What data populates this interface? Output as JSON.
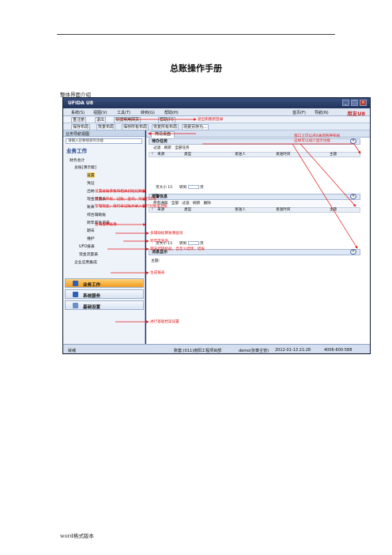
{
  "doc": {
    "title": "总账操作手册",
    "section": "整体界面介绍",
    "footer": "word格式版本"
  },
  "app": {
    "window_title": "UFIDA U8",
    "brand": "用友U8",
    "menus": [
      "系统(S)",
      "视图(V)",
      "工具(T)",
      "转到(G)",
      "帮助(H)"
    ],
    "home_links": [
      "首页(F)",
      "导航(N)"
    ],
    "toolbar1": [
      "重注册",
      "退出",
      "快捷常用网页",
      "帮助(H)"
    ],
    "toolbar2": [
      "保存布局",
      "恢复布局",
      "保存所有布局",
      "恢复所有布局",
      "场景另存为..."
    ],
    "nav": {
      "header": "业务导航视图",
      "search_placeholder": "请输入您要搜索的功能",
      "section": "业务工作",
      "tree": [
        "财务会计",
        "总账[演示版]",
        "设置",
        "凭证",
        "出纳",
        "现金流量表",
        "账表",
        "综合辅助账",
        "跨年度查询表",
        "期末",
        "维护",
        "UFO报表",
        "现金流量表",
        "企业应用集成"
      ],
      "buttons": [
        "业务工作",
        "系统服务",
        "基础设置"
      ]
    },
    "main": {
      "tab": "简易桌面",
      "panels": [
        {
          "title": "待办任务",
          "tools": [
            "过滤",
            "刷新",
            "全部任务"
          ],
          "columns": [
            "!",
            "来源",
            "类型",
            "发送人",
            "发送时间",
            "主题"
          ],
          "page_size_label": "页大小",
          "page_size": "15",
          "goto_label": "转到",
          "page_label": "页"
        },
        {
          "title": "报警信息",
          "tools": [
            "所有通知",
            "全部",
            "过滤",
            "刷新",
            "删除"
          ],
          "columns": [
            "!",
            "来源",
            "类型",
            "发送人",
            "发送时间",
            "主题"
          ],
          "page_size_label": "页大小",
          "page_size": "15",
          "goto_label": "转到",
          "page_label": "页"
        },
        {
          "title": "消息显示",
          "body_label": "主题:"
        }
      ]
    },
    "status": {
      "ready": "就绪",
      "account": "账套:(011)南阳工程项目部",
      "user": "demo(张泰主管)",
      "date": "2012-01-13 21:28",
      "phone": "4006-600-588"
    },
    "annotations": {
      "exit_login": "退出和重新登录",
      "panel_note_1": "窗口上可以点X关闭各种布局",
      "panel_note_2": "这样可以减少显示功能",
      "settings": "设置总账参数和相关初始化数据",
      "voucher": "填制，审核，记账，查询，凭证打印等",
      "cashier": "管理现金，银行日记账并录入银行对账单对账",
      "ledger": "查询各种账簿",
      "aux": "多辅助核算账簿查询",
      "cross_year": "跨年度查询",
      "period_end": "期末结转损益，自定义结转，结账",
      "ufo": "生成报表",
      "basic_settings": "进行基础档案设置"
    },
    "colors": {
      "annotation": "#e01818",
      "title_bar": "#22345c",
      "nav_active": "#f29b1d"
    }
  }
}
